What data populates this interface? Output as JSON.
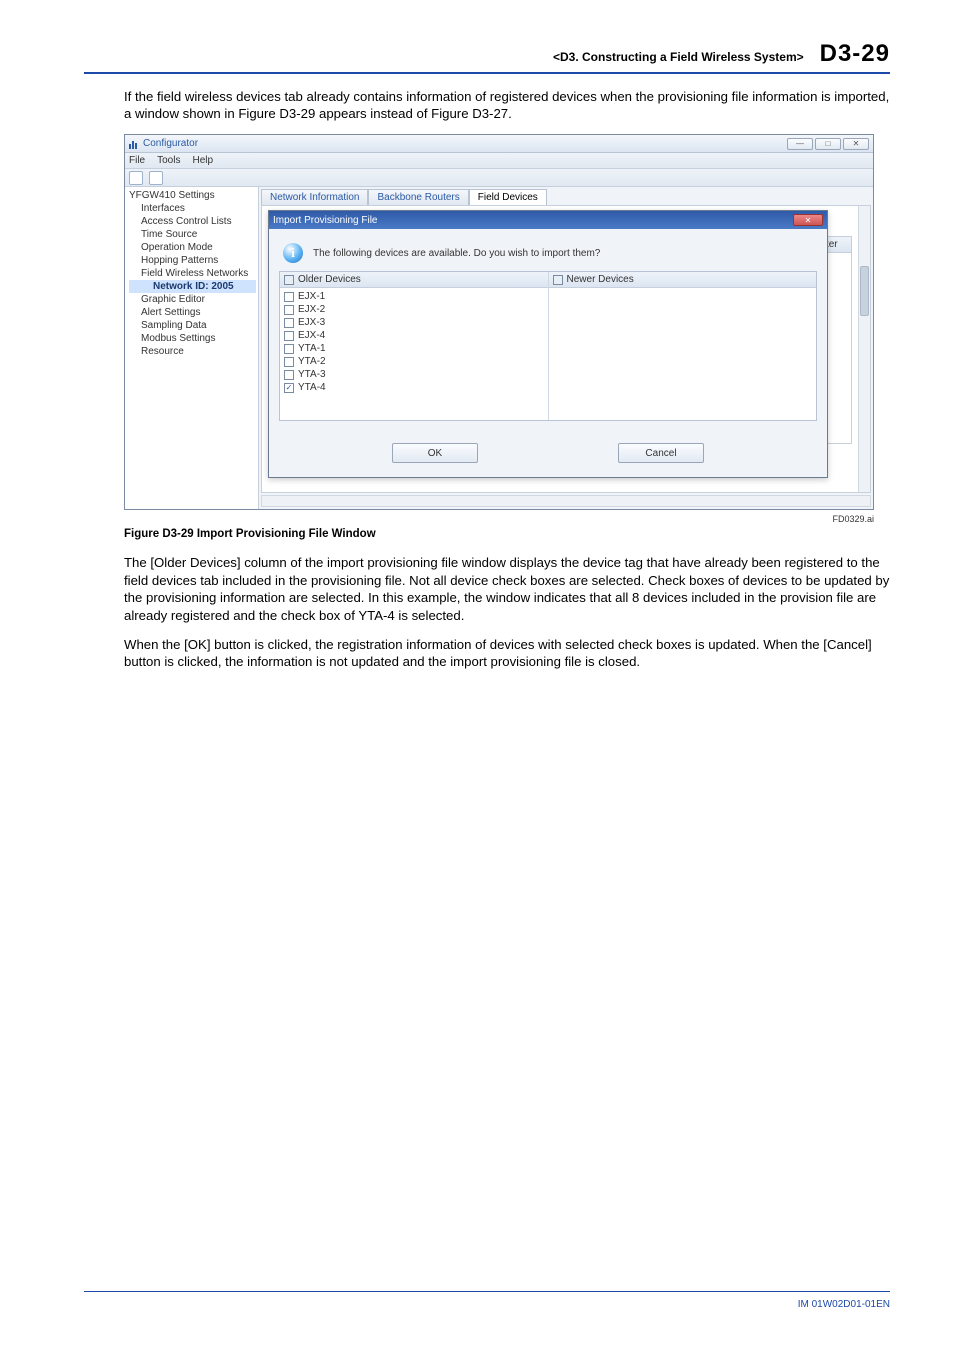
{
  "header": {
    "chapter": "<D3.  Constructing a Field Wireless System>",
    "page": "D3-29"
  },
  "intro": "If the field wireless devices tab already contains information of registered devices when the provisioning file information is imported, a window shown in Figure D3-29 appears instead of Figure D3-27.",
  "window": {
    "title": "Configurator",
    "menus": {
      "file": "File",
      "tools": "Tools",
      "help": "Help"
    },
    "tree": {
      "root": "YFGW410 Settings",
      "items": [
        "Interfaces",
        "Access Control Lists",
        "Time Source",
        "Operation Mode",
        "Hopping Patterns",
        "Field Wireless Networks",
        "Network ID: 2005",
        "Graphic Editor",
        "Alert Settings",
        "Sampling Data",
        "Modbus Settings",
        "Resource"
      ]
    },
    "tabs": {
      "netinfo": "Network Information",
      "backbone": "Backbone Routers",
      "field": "Field Devices"
    },
    "right": {
      "secondary_router": "Secondary Router"
    }
  },
  "dialog": {
    "title": "Import Provisioning File",
    "message": "The following devices are available. Do you wish to import them?",
    "older_header": "Older Devices",
    "newer_header": "Newer Devices",
    "items": [
      {
        "label": "EJX-1",
        "checked": false
      },
      {
        "label": "EJX-2",
        "checked": false
      },
      {
        "label": "EJX-3",
        "checked": false
      },
      {
        "label": "EJX-4",
        "checked": false
      },
      {
        "label": "YTA-1",
        "checked": false
      },
      {
        "label": "YTA-2",
        "checked": false
      },
      {
        "label": "YTA-3",
        "checked": false
      },
      {
        "label": "YTA-4",
        "checked": true
      }
    ],
    "ok": "OK",
    "cancel": "Cancel"
  },
  "figref": "FD0329.ai",
  "caption": "Figure D3-29  Import Provisioning File Window",
  "para1": "The [Older Devices] column of the import provisioning file window displays the device tag that have already been registered to the field devices tab included in the provisioning file. Not all device check boxes are selected. Check boxes of devices to be updated by the provisioning information are selected. In this example, the window indicates that all 8 devices included in the provision file are already registered and the check box of YTA-4 is selected.",
  "para2": "When the [OK] button is clicked, the registration information of devices with selected check boxes is updated. When the [Cancel] button is clicked, the information is not updated and the import provisioning file is closed.",
  "footer": "IM 01W02D01-01EN"
}
